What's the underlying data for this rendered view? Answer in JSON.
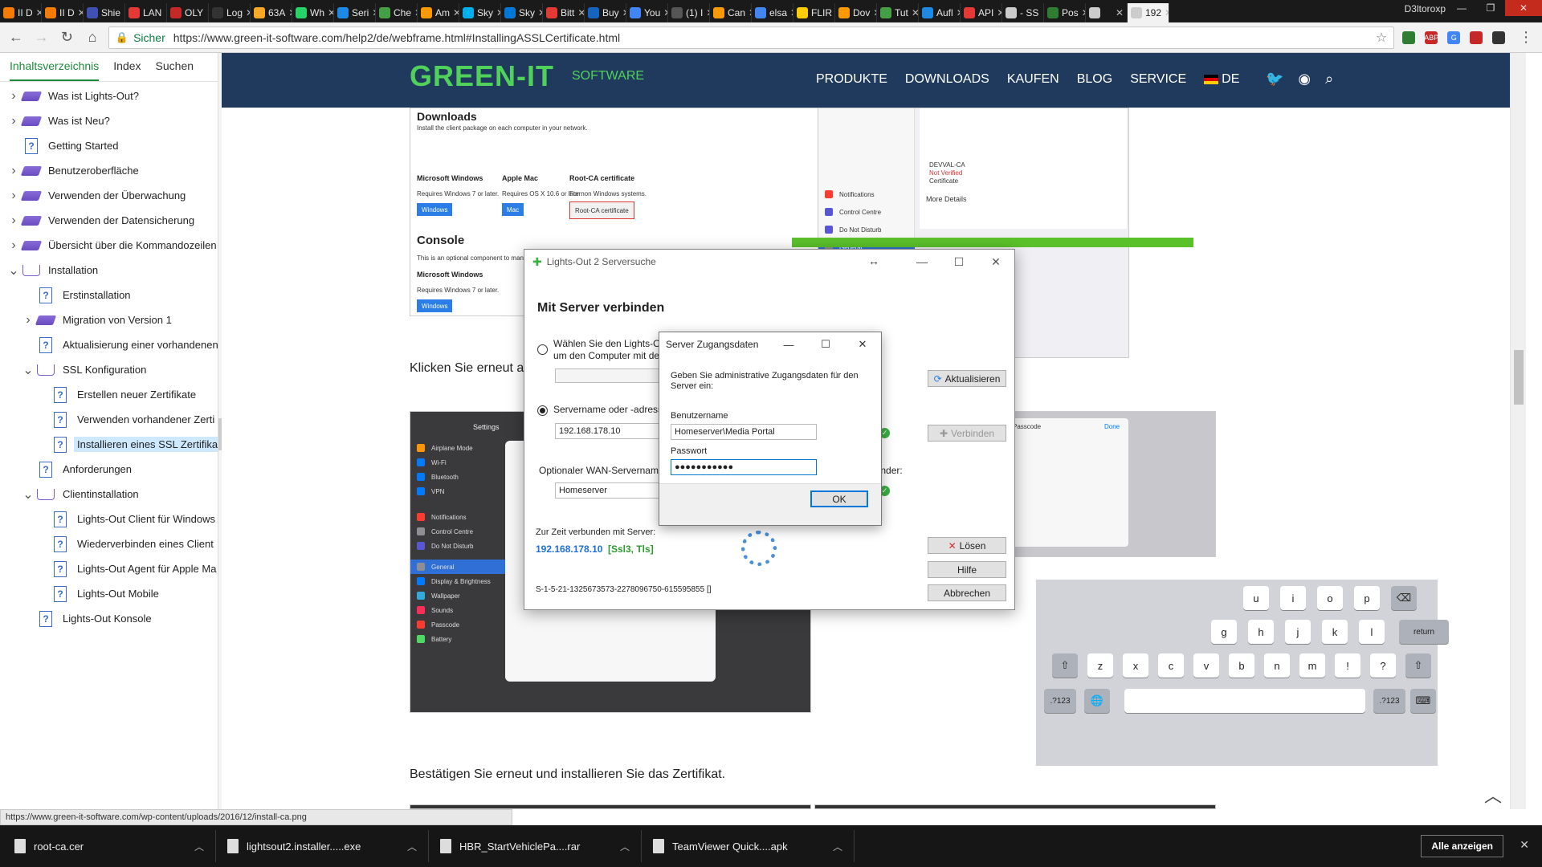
{
  "browser": {
    "tabs": [
      {
        "label": "II D",
        "color": "#f57c00"
      },
      {
        "label": "II D",
        "color": "#f57c00"
      },
      {
        "label": "Shie",
        "color": "#3f51b5"
      },
      {
        "label": "LAN",
        "color": "#e53935"
      },
      {
        "label": "OLY",
        "color": "#c62828"
      },
      {
        "label": "Log",
        "color": "#333333"
      },
      {
        "label": "63A",
        "color": "#f9a825"
      },
      {
        "label": "Wh",
        "color": "#25d366"
      },
      {
        "label": "Seri",
        "color": "#1e88e5"
      },
      {
        "label": "Che",
        "color": "#43a047"
      },
      {
        "label": "Am",
        "color": "#ff9900"
      },
      {
        "label": "Sky",
        "color": "#00aff0"
      },
      {
        "label": "Sky",
        "color": "#0078d7"
      },
      {
        "label": "Bitt",
        "color": "#e53935"
      },
      {
        "label": "Buy",
        "color": "#1565c0"
      },
      {
        "label": "You",
        "color": "#4285f4"
      },
      {
        "label": "(1) I",
        "color": "#555555"
      },
      {
        "label": "Can",
        "color": "#ff9900"
      },
      {
        "label": "elsa",
        "color": "#4285f4"
      },
      {
        "label": "FLIR",
        "color": "#ffcc00"
      },
      {
        "label": "Dov",
        "color": "#ff9900"
      },
      {
        "label": "Tut",
        "color": "#43a047"
      },
      {
        "label": "Aufl",
        "color": "#1e88e5"
      },
      {
        "label": "API",
        "color": "#e53935"
      },
      {
        "label": "- SS",
        "color": "#cccccc"
      },
      {
        "label": "Pos",
        "color": "#2e7d32"
      },
      {
        "label": "",
        "color": "#cccccc"
      },
      {
        "label": "192",
        "color": "#cccccc"
      }
    ],
    "profile": "D3ltoroxp",
    "secure_label": "Sicher",
    "url": "https://www.green-it-software.com/help2/de/webframe.html#InstallingASSLCertificate.html",
    "extensions": [
      {
        "text": "",
        "color": "#2e7d32"
      },
      {
        "text": "ABP",
        "color": "#c62828"
      },
      {
        "text": "G",
        "color": "#4285f4"
      },
      {
        "text": "",
        "color": "#c62828"
      },
      {
        "text": "",
        "color": "#333333"
      }
    ]
  },
  "help": {
    "tabs": [
      "Inhaltsverzeichnis",
      "Index",
      "Suchen"
    ],
    "tree": [
      {
        "label": "Was ist Lights-Out?",
        "level": 0,
        "kind": "book",
        "chevron": ">"
      },
      {
        "label": "Was ist Neu?",
        "level": 0,
        "kind": "book",
        "chevron": ">"
      },
      {
        "label": "Getting Started",
        "level": 0,
        "kind": "page",
        "chevron": ""
      },
      {
        "label": "Benutzeroberfläche",
        "level": 0,
        "kind": "book",
        "chevron": ">"
      },
      {
        "label": "Verwenden der Überwachung",
        "level": 0,
        "kind": "book",
        "chevron": ">"
      },
      {
        "label": "Verwenden der Datensicherung",
        "level": 0,
        "kind": "book",
        "chevron": ">"
      },
      {
        "label": "Übersicht über die Kommandozeilen",
        "level": 0,
        "kind": "book",
        "chevron": ">"
      },
      {
        "label": "Installation",
        "level": 0,
        "kind": "open",
        "chevron": "v"
      },
      {
        "label": "Erstinstallation",
        "level": 1,
        "kind": "page",
        "chevron": ""
      },
      {
        "label": "Migration von Version 1",
        "level": 1,
        "kind": "book",
        "chevron": ">"
      },
      {
        "label": "Aktualisierung einer vorhandenen",
        "level": 1,
        "kind": "page",
        "chevron": ""
      },
      {
        "label": "SSL Konfiguration",
        "level": 1,
        "kind": "open",
        "chevron": "v"
      },
      {
        "label": "Erstellen neuer Zertifikate",
        "level": 2,
        "kind": "page",
        "chevron": ""
      },
      {
        "label": "Verwenden vorhandener Zerti",
        "level": 2,
        "kind": "page",
        "chevron": ""
      },
      {
        "label": "Installieren eines SSL Zertifika",
        "level": 2,
        "kind": "page",
        "chevron": "",
        "selected": true
      },
      {
        "label": "Anforderungen",
        "level": 1,
        "kind": "page",
        "chevron": ""
      },
      {
        "label": "Clientinstallation",
        "level": 1,
        "kind": "open",
        "chevron": "v"
      },
      {
        "label": "Lights-Out Client für Windows",
        "level": 2,
        "kind": "page",
        "chevron": ""
      },
      {
        "label": "Wiederverbinden eines Client",
        "level": 2,
        "kind": "page",
        "chevron": ""
      },
      {
        "label": "Lights-Out Agent für Apple Ma",
        "level": 2,
        "kind": "page",
        "chevron": ""
      },
      {
        "label": "Lights-Out Mobile",
        "level": 2,
        "kind": "page",
        "chevron": ""
      },
      {
        "label": "Lights-Out Konsole",
        "level": 1,
        "kind": "page",
        "chevron": ""
      }
    ]
  },
  "site": {
    "logo": "GREEN-IT",
    "logo_sub": "SOFTWARE",
    "nav": [
      "PRODUKTE",
      "DOWNLOADS",
      "KAUFEN",
      "BLOG",
      "SERVICE"
    ],
    "lang": "DE",
    "downloads_heading": "Downloads",
    "download_intro": "Install the client package on each computer in your network.",
    "col_windows": "Microsoft Windows",
    "col_mac": "Apple Mac",
    "col_rootca": "Root-CA certificate",
    "req_windows": "Requires Windows 7 or later.",
    "req_mac": "Requires OS X 10.6 or later.",
    "req_rootca": "For non Windows systems.",
    "btn_windows": "Windows",
    "btn_mac": "Mac",
    "btn_rootca": "Root-CA certificate",
    "console_heading": "Console",
    "console_text": "This is an optional component to manage Lights-Out from a client machine.",
    "console_req": "Requires Windows 7 or later.",
    "paragraph_1": "Klicken Sie erneut a",
    "paragraph_2": "Bestätigen Sie erneut und installieren Sie das Zertifikat.",
    "ipad_settings_title": "Settings",
    "ipad_top": [
      "Notifications",
      "Control Centre",
      "Do Not Disturb",
      "General",
      "Display & Brightness"
    ],
    "ipad_more_details": "More Details",
    "ipad_cert_signed": "DEVVAL-CA",
    "ipad_cert_status": "Not Verified",
    "ipad_cert_contains": "Certificate",
    "settings_items": [
      {
        "label": "Airplane Mode",
        "color": "#ff9500"
      },
      {
        "label": "Wi-Fi",
        "color": "#007aff"
      },
      {
        "label": "Bluetooth",
        "color": "#007aff"
      },
      {
        "label": "VPN",
        "color": "#007aff"
      },
      {
        "label": "Notifications",
        "color": "#ff3b30"
      },
      {
        "label": "Control Centre",
        "color": "#8e8e93"
      },
      {
        "label": "Do Not Disturb",
        "color": "#5856d6"
      },
      {
        "label": "General",
        "color": "#8e8e93"
      },
      {
        "label": "Display & Brightness",
        "color": "#007aff"
      },
      {
        "label": "Wallpaper",
        "color": "#34aadc"
      },
      {
        "label": "Sounds",
        "color": "#ff2d55"
      },
      {
        "label": "Passcode",
        "color": "#ff3b30"
      },
      {
        "label": "Battery",
        "color": "#4cd964"
      }
    ],
    "ipad_right_title": "Passcode",
    "ipad_right_done": "Done",
    "keyboard_rows": [
      [
        "u",
        "i",
        "o",
        "p",
        "⌫"
      ],
      [
        "g",
        "h",
        "j",
        "k",
        "l",
        "return"
      ],
      [
        "⇧",
        "z",
        "x",
        "c",
        "v",
        "b",
        "n",
        "m",
        "!",
        "?",
        "⇧"
      ],
      [
        ".?123",
        "🌐",
        "",
        ".?123",
        "⌨"
      ]
    ]
  },
  "dialog": {
    "title": "Lights-Out 2 Serversuche",
    "heading": "Mit Server verbinden",
    "radio1_label": "Wählen Sie den Lights-O",
    "radio1_label2": "um den Computer mit de",
    "radio2_label": "Servername oder -adress",
    "server_value": "192.168.178.10",
    "wan_label": "Optionaler WAN-Servernam",
    "wan_suffix": "wender:",
    "wan_value": "Homeserver",
    "btn_refresh": "Aktualisieren",
    "btn_connect": "Verbinden",
    "connected_label": "Zur Zeit verbunden mit Server:",
    "connected_ip": "192.168.178.10",
    "connected_proto": "[Ssl3, Tls]",
    "sid": "S-1-5-21-1325673573-2278096750-615595855 []",
    "btn_solve": "Lösen",
    "btn_help": "Hilfe",
    "btn_cancel": "Abbrechen"
  },
  "credentials": {
    "title": "Server Zugangsdaten",
    "prompt": "Geben Sie administrative Zugangsdaten für den Server ein:",
    "user_label": "Benutzername",
    "user_value": "Homeserver\\Media Portal",
    "pass_label": "Passwort",
    "pass_value": "●●●●●●●●●●●",
    "ok": "OK"
  },
  "status_url": "https://www.green-it-software.com/wp-content/uploads/2016/12/install-ca.png",
  "downloads": [
    {
      "name": "root-ca.cer"
    },
    {
      "name": "lightsout2.installer.....exe"
    },
    {
      "name": "HBR_StartVehiclePa....rar"
    },
    {
      "name": "TeamViewer Quick....apk"
    }
  ],
  "show_all": "Alle anzeigen"
}
